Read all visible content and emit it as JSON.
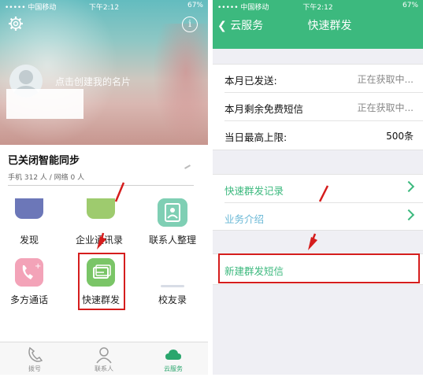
{
  "left": {
    "status": {
      "carrier": "••••• 中国移动",
      "time": "下午2:12",
      "battery": "67%"
    },
    "header": {
      "create_card": "点击创建我的名片"
    },
    "sync": {
      "title": "已关闭智能同步",
      "stats": "手机 312 人 / 网络 0 人"
    },
    "grid": [
      {
        "label": "发现",
        "icon": "discover-icon"
      },
      {
        "label": "企业通讯录",
        "icon": "enterprise-contacts-icon"
      },
      {
        "label": "联系人整理",
        "icon": "contact-organize-icon"
      },
      {
        "label": "多方通话",
        "icon": "multi-call-icon"
      },
      {
        "label": "快速群发",
        "icon": "quick-broadcast-icon"
      },
      {
        "label": "校友录",
        "icon": "alumni-icon"
      }
    ],
    "tabs": [
      {
        "label": "拨号",
        "icon": "phone-icon"
      },
      {
        "label": "联系人",
        "icon": "person-icon"
      },
      {
        "label": "云服务",
        "icon": "cloud-icon"
      }
    ]
  },
  "right": {
    "status": {
      "carrier": "••••• 中国移动",
      "time": "下午2:12",
      "battery": "67%"
    },
    "nav": {
      "back_label": "云服务",
      "title": "快速群发"
    },
    "stats_rows": [
      {
        "label": "本月已发送:",
        "value": "正在获取中..."
      },
      {
        "label": "本月剩余免费短信",
        "value": "正在获取中..."
      },
      {
        "label": "当日最高上限:",
        "value": "500条"
      }
    ],
    "links": [
      {
        "label": "快速群发记录"
      },
      {
        "label": "业务介绍"
      }
    ],
    "new_sms": "新建群发短信"
  },
  "colors": {
    "accent": "#3cb97e",
    "highlight_red": "#d51d1d"
  }
}
